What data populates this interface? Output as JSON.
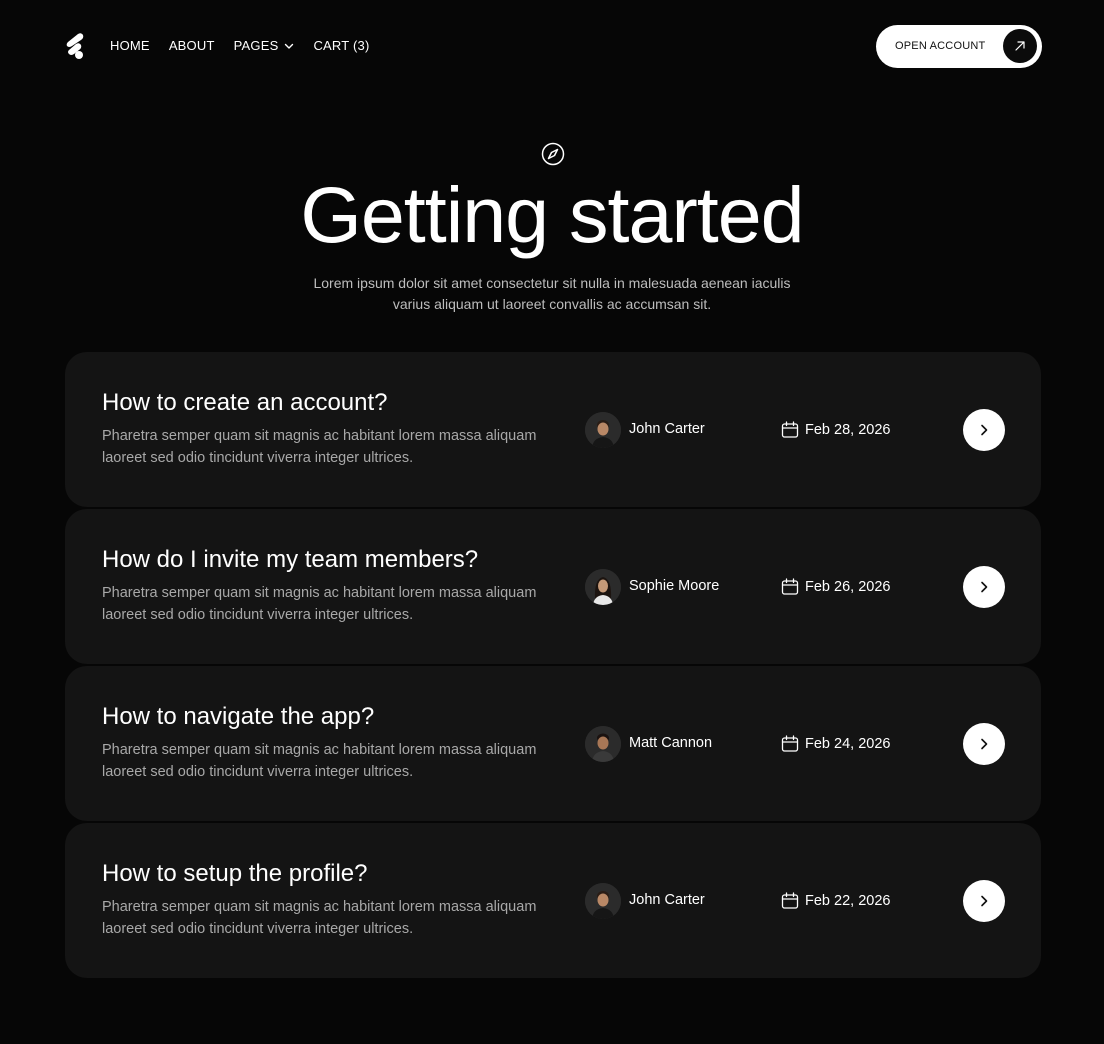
{
  "nav": {
    "logo_icon": "brand-logo-icon",
    "items": [
      {
        "label": "HOME"
      },
      {
        "label": "ABOUT"
      },
      {
        "label": "PAGES",
        "icon": "chevron-down-icon"
      },
      {
        "label": "CART (3)"
      }
    ],
    "cta_label": "OPEN ACCOUNT",
    "cta_icon": "arrow-up-right-icon"
  },
  "hero": {
    "icon": "compass-icon",
    "title": "Getting started",
    "subtitle": "Lorem ipsum dolor sit amet consectetur sit nulla in malesuada aenean iaculis varius aliquam ut laoreet convallis ac accumsan sit."
  },
  "articles": [
    {
      "title": "How to create an account?",
      "description": "Pharetra semper quam sit magnis ac habitant lorem massa aliquam laoreet sed odio tincidunt viverra integer ultrices.",
      "author": "John Carter",
      "date": "Feb 28, 2026"
    },
    {
      "title": "How do I invite my team members?",
      "description": "Pharetra semper quam sit magnis ac habitant lorem massa aliquam laoreet sed odio tincidunt viverra integer ultrices.",
      "author": "Sophie Moore",
      "date": "Feb 26, 2026"
    },
    {
      "title": "How to navigate the app?",
      "description": "Pharetra semper quam sit magnis ac habitant lorem massa aliquam laoreet sed odio tincidunt viverra integer ultrices.",
      "author": "Matt Cannon",
      "date": "Feb 24, 2026"
    },
    {
      "title": "How to setup the profile?",
      "description": "Pharetra semper quam sit magnis ac habitant lorem massa aliquam laoreet sed odio tincidunt viverra integer ultrices.",
      "author": "John Carter",
      "date": "Feb 22, 2026"
    }
  ],
  "colors": {
    "background": "#060606",
    "card": "#141414",
    "text": "#ffffff",
    "muted": "#a8a8a8"
  }
}
